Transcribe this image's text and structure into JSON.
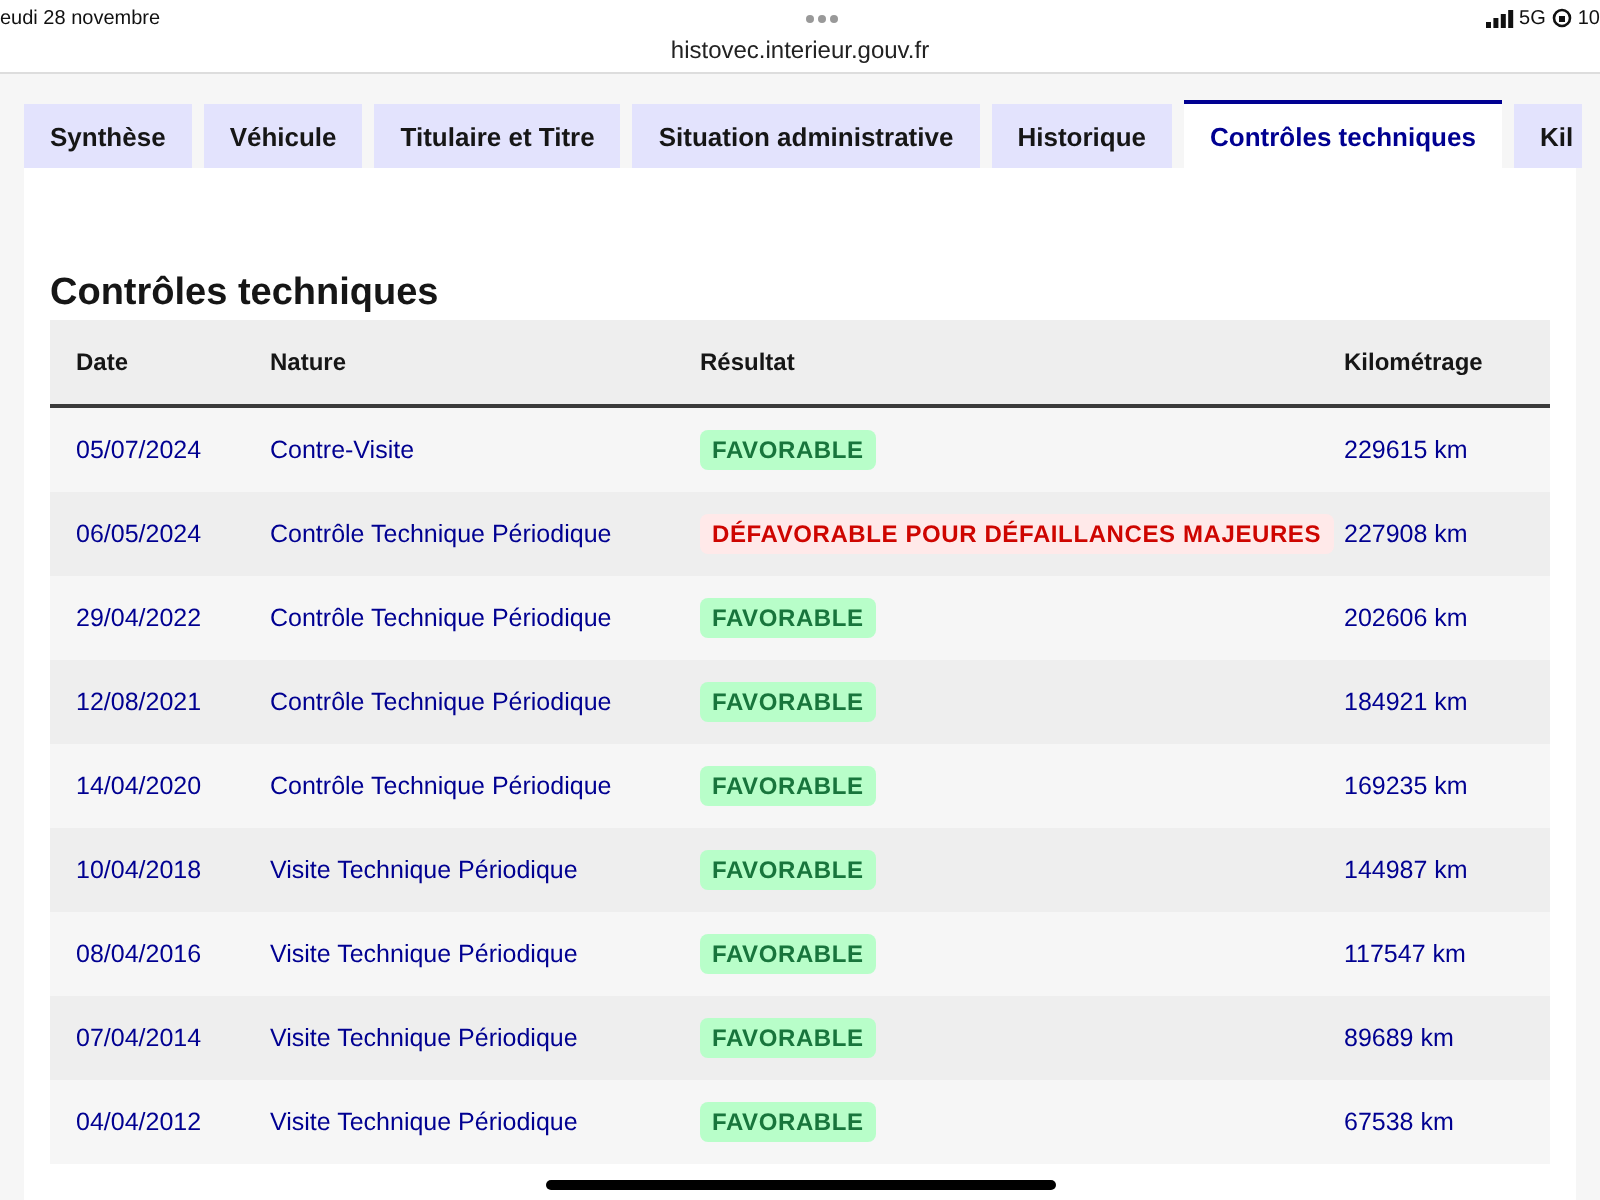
{
  "status_bar": {
    "date": "eudi 28 novembre",
    "network": "5G",
    "battery": "10"
  },
  "browser": {
    "url": "histovec.interieur.gouv.fr"
  },
  "tabs": [
    {
      "label": "Synthèse",
      "selected": false
    },
    {
      "label": "Véhicule",
      "selected": false
    },
    {
      "label": "Titulaire et Titre",
      "selected": false
    },
    {
      "label": "Situation administrative",
      "selected": false
    },
    {
      "label": "Historique",
      "selected": false
    },
    {
      "label": "Contrôles techniques",
      "selected": true
    },
    {
      "label": "Kil",
      "selected": false
    }
  ],
  "section": {
    "title": "Contrôles techniques"
  },
  "table": {
    "columns": [
      "Date",
      "Nature",
      "Résultat",
      "Kilométrage"
    ],
    "rows": [
      {
        "date": "05/07/2024",
        "nature": "Contre-Visite",
        "result": {
          "label": "FAVORABLE",
          "kind": "success"
        },
        "km": "229615 km"
      },
      {
        "date": "06/05/2024",
        "nature": "Contrôle Technique Périodique",
        "result": {
          "label": "DÉFAVORABLE POUR DÉFAILLANCES MAJEURES",
          "kind": "error"
        },
        "km": "227908 km"
      },
      {
        "date": "29/04/2022",
        "nature": "Contrôle Technique Périodique",
        "result": {
          "label": "FAVORABLE",
          "kind": "success"
        },
        "km": "202606 km"
      },
      {
        "date": "12/08/2021",
        "nature": "Contrôle Technique Périodique",
        "result": {
          "label": "FAVORABLE",
          "kind": "success"
        },
        "km": "184921 km"
      },
      {
        "date": "14/04/2020",
        "nature": "Contrôle Technique Périodique",
        "result": {
          "label": "FAVORABLE",
          "kind": "success"
        },
        "km": "169235 km"
      },
      {
        "date": "10/04/2018",
        "nature": "Visite Technique Périodique",
        "result": {
          "label": "FAVORABLE",
          "kind": "success"
        },
        "km": "144987 km"
      },
      {
        "date": "08/04/2016",
        "nature": "Visite Technique Périodique",
        "result": {
          "label": "FAVORABLE",
          "kind": "success"
        },
        "km": "117547 km"
      },
      {
        "date": "07/04/2014",
        "nature": "Visite Technique Périodique",
        "result": {
          "label": "FAVORABLE",
          "kind": "success"
        },
        "km": "89689 km"
      },
      {
        "date": "04/04/2012",
        "nature": "Visite Technique Périodique",
        "result": {
          "label": "FAVORABLE",
          "kind": "success"
        },
        "km": "67538 km"
      }
    ]
  }
}
